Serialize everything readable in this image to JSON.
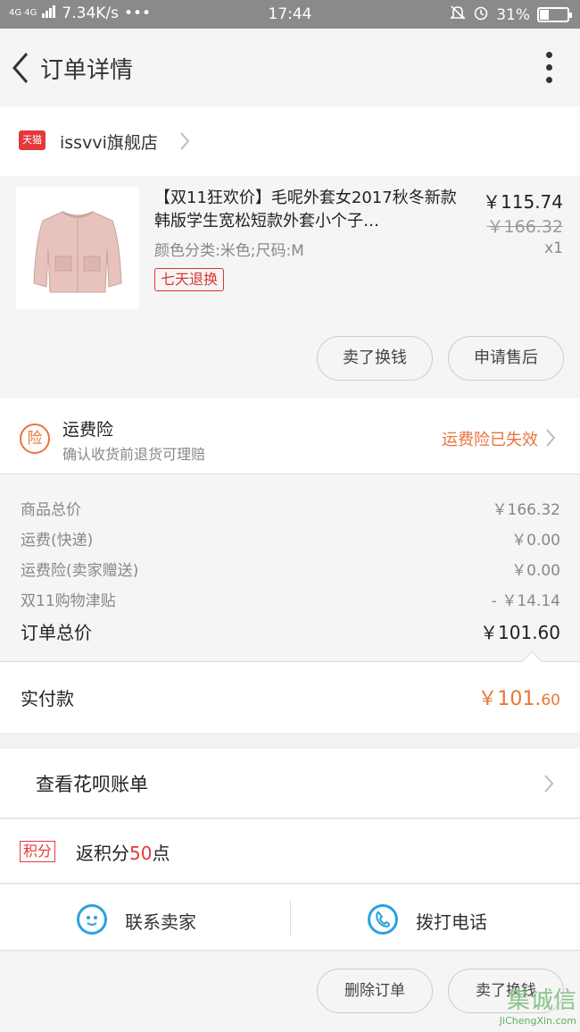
{
  "status_bar": {
    "network": "4G 4G",
    "speed": "7.34K/s",
    "dots": "•••",
    "time": "17:44",
    "battery_text": "31%",
    "battery_level": 0.31
  },
  "header": {
    "title": "订单详情"
  },
  "shop": {
    "badge": "天猫",
    "name": "issvvi旗舰店"
  },
  "product": {
    "title": "【双11狂欢价】毛呢外套女2017秋冬新款韩版学生宽松短款外套小个子…",
    "sku": "颜色分类:米色;尺码:M",
    "tag": "七天退换",
    "price": "￥115.74",
    "original_price": "￥166.32",
    "quantity": "x1",
    "actions": [
      "卖了换钱",
      "申请售后"
    ]
  },
  "insurance": {
    "icon_text": "险",
    "title": "运费险",
    "subtitle": "确认收货前退货可理赔",
    "status": "运费险已失效"
  },
  "totals": {
    "rows": [
      {
        "label": "商品总价",
        "value": "￥166.32"
      },
      {
        "label": "运费(快递)",
        "value": "￥0.00"
      },
      {
        "label": "运费险(卖家赠送)",
        "value": "￥0.00"
      },
      {
        "label": "双11购物津贴",
        "value": "- ￥14.14"
      }
    ],
    "order_total_label": "订单总价",
    "order_total_value": "￥101.60"
  },
  "payment": {
    "label": "实付款",
    "amount_main": "￥101.",
    "amount_cents": "60"
  },
  "huabei": {
    "label": "查看花呗账单"
  },
  "points": {
    "badge": "积分",
    "prefix": "返积分",
    "number": "50",
    "suffix": "点"
  },
  "contact": {
    "seller": "联系卖家",
    "phone": "拨打电话"
  },
  "bottom_actions": [
    "删除订单",
    "卖了换钱"
  ],
  "watermark": {
    "brand": "集诚信",
    "site": "JiChengXin.com"
  },
  "colors": {
    "accent": "#e8753a",
    "tmall_red": "#e4393c",
    "blue": "#2aa2e0"
  }
}
